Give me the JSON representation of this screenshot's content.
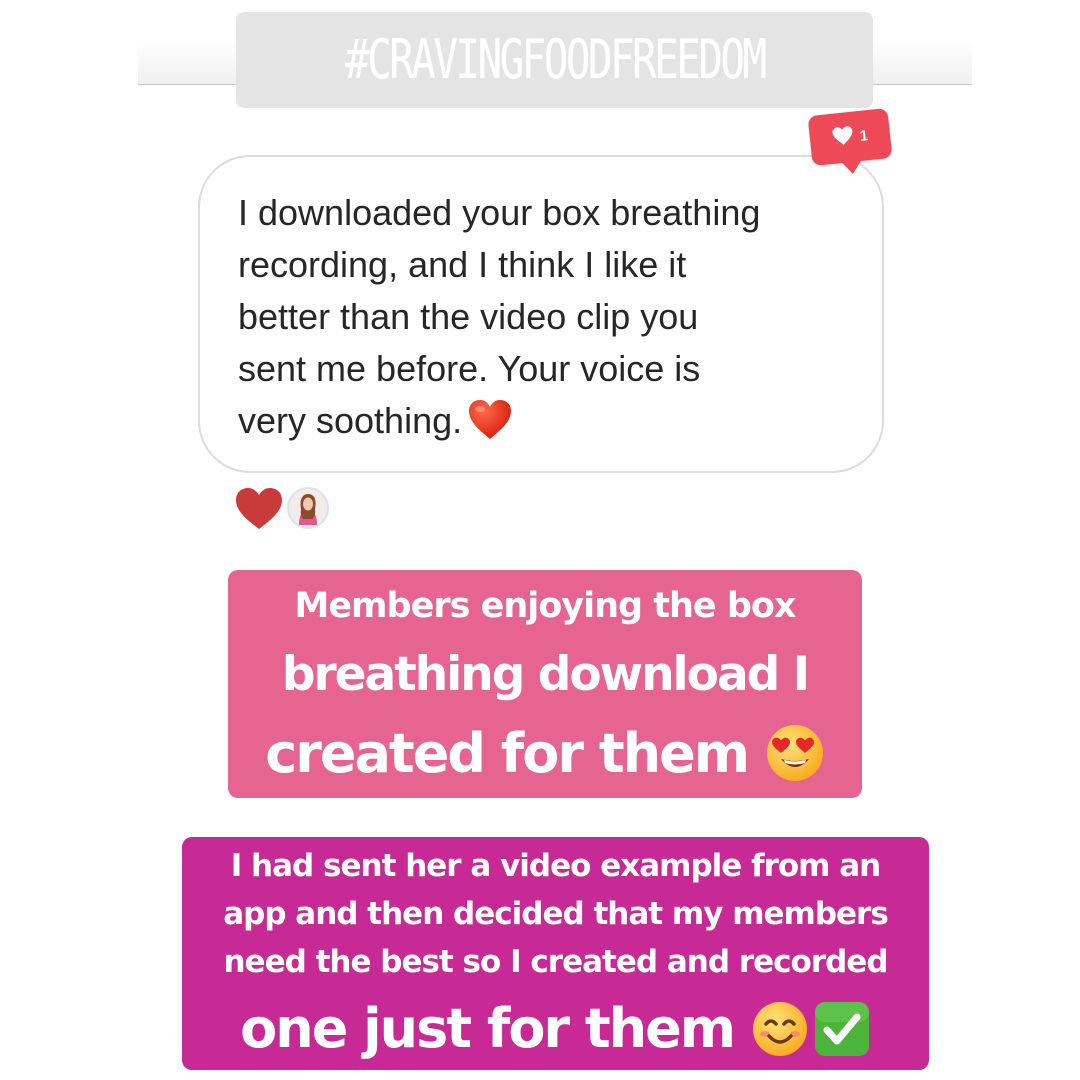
{
  "story": {
    "hashtag": "#CRAVINGFOODFREEDOM"
  },
  "message": {
    "text": "I downloaded your box breathing recording, and I think I like it better than the video clip you sent me before. Your voice is very soothing.",
    "lines": [
      "I downloaded your box breathing",
      "recording, and I think I like it",
      "better than the video clip you",
      "sent me before. Your voice is",
      "very soothing."
    ],
    "trailing_emoji": "red-heart-emoji",
    "like_count": "1"
  },
  "reactions": {
    "heart_icon": "heart-icon",
    "avatar_icon": "avatar"
  },
  "caption1": {
    "lines": [
      "Members enjoying the box",
      "breathing download I",
      "created for them"
    ],
    "emoji": "heart-eyes-emoji",
    "color": "#e56590"
  },
  "caption2": {
    "lines": [
      "I had sent her a video example from an",
      "app and then decided that my members",
      "need the best so I created and recorded",
      "one just for them"
    ],
    "emojis": [
      "smiling-face-emoji",
      "check-mark-button-emoji"
    ],
    "color": "#c72a94"
  },
  "colors": {
    "like_badge": "#ed4956",
    "bubble_border": "#dcdcdc",
    "text": "#262626"
  }
}
